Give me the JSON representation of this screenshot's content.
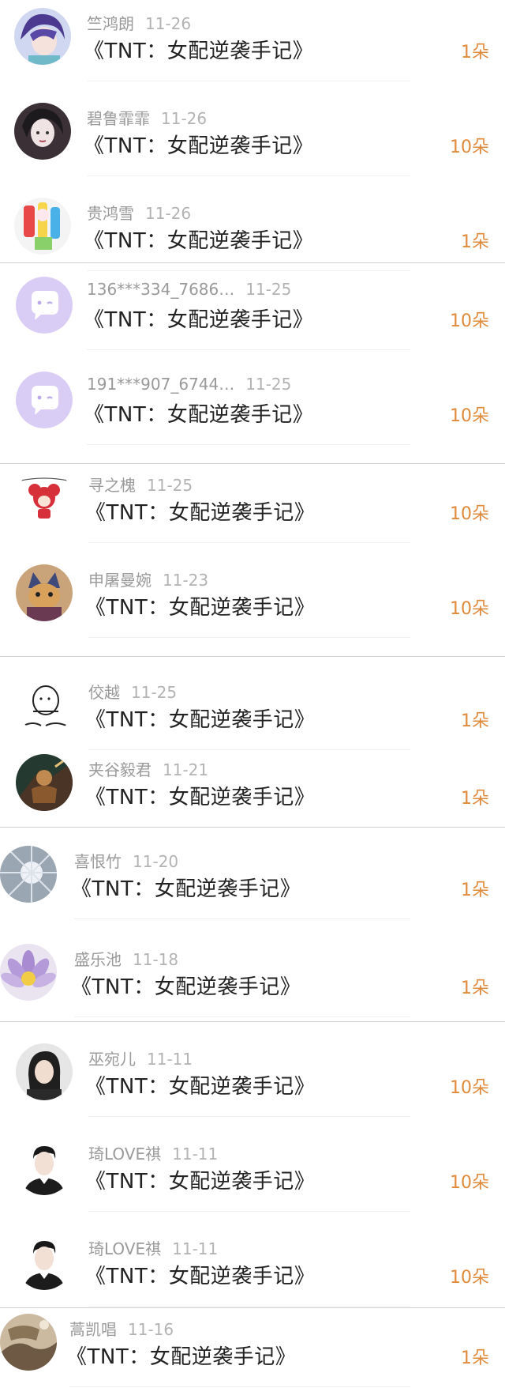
{
  "colors": {
    "accent": "#e08a3c",
    "name": "#9a9a9a",
    "date": "#b3b3b3",
    "title": "#222222"
  },
  "rows": [
    {
      "name": "竺鸿朗",
      "date": "11-26",
      "title": "《TNT：女配逆袭手记》",
      "amount": "1朵",
      "avatar": "anime-purple-hair-avatar"
    },
    {
      "name": "碧鲁霏霏",
      "date": "11-26",
      "title": "《TNT：女配逆袭手记》",
      "amount": "10朵",
      "avatar": "dark-girl-avatar"
    },
    {
      "name": "贵鸿雪",
      "date": "11-26",
      "title": "《TNT：女配逆袭手记》",
      "amount": "1朵",
      "avatar": "colorful-toy-avatar"
    },
    {
      "name": "136***334_7686…",
      "date": "11-25",
      "title": "《TNT：女配逆袭手记》",
      "amount": "10朵",
      "avatar": "default-chat-avatar"
    },
    {
      "name": "191***907_6744…",
      "date": "11-25",
      "title": "《TNT：女配逆袭手记》",
      "amount": "10朵",
      "avatar": "default-chat-avatar"
    },
    {
      "name": "寻之槐",
      "date": "11-25",
      "title": "《TNT：女配逆袭手记》",
      "amount": "10朵",
      "avatar": "red-cartoon-avatar"
    },
    {
      "name": "申屠曼婉",
      "date": "11-23",
      "title": "《TNT：女配逆袭手记》",
      "amount": "10朵",
      "avatar": "cat-avatar"
    },
    {
      "name": "佼越",
      "date": "11-25",
      "title": "《TNT：女配逆袭手记》",
      "amount": "1朵",
      "avatar": "doodle-avatar"
    },
    {
      "name": "夹谷毅君",
      "date": "11-21",
      "title": "《TNT：女配逆袭手记》",
      "amount": "1朵",
      "avatar": "game-hero-avatar"
    },
    {
      "name": "喜恨竹",
      "date": "11-20",
      "title": "《TNT：女配逆袭手记》",
      "amount": "1朵",
      "avatar": "frost-avatar"
    },
    {
      "name": "盛乐池",
      "date": "11-18",
      "title": "《TNT：女配逆袭手记》",
      "amount": "1朵",
      "avatar": "lotus-flower-avatar"
    },
    {
      "name": "巫宛儿",
      "date": "11-11",
      "title": "《TNT：女配逆袭手记》",
      "amount": "10朵",
      "avatar": "woman-portrait-avatar"
    },
    {
      "name": "琦LOVE祺",
      "date": "11-11",
      "title": "《TNT：女配逆袭手记》",
      "amount": "10朵",
      "avatar": "boy-portrait-avatar"
    },
    {
      "name": "琦LOVE祺",
      "date": "11-11",
      "title": "《TNT：女配逆袭手记》",
      "amount": "10朵",
      "avatar": "boy-portrait-avatar"
    },
    {
      "name": "蒿凯唱",
      "date": "11-16",
      "title": "《TNT：女配逆袭手记》",
      "amount": "1朵",
      "avatar": "rock-landscape-avatar"
    }
  ]
}
